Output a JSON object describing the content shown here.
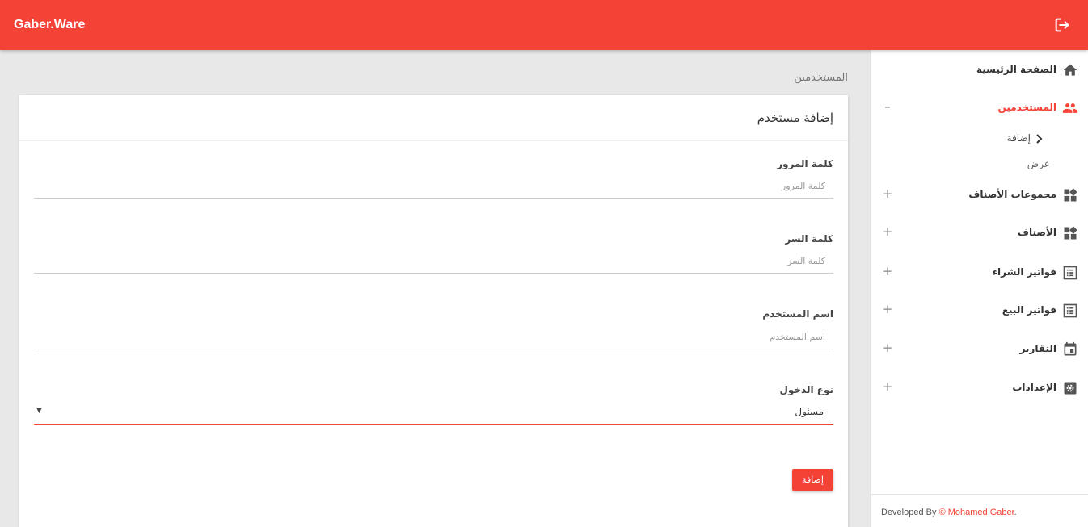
{
  "brand": "Gaber.Ware",
  "breadcrumb": "المستخدمين",
  "form": {
    "title": "إضافة مستخدم",
    "fields": [
      {
        "label": "كلمة المرور",
        "placeholder": "كلمة المرور"
      },
      {
        "label": "كلمة السر",
        "placeholder": "كلمة السر"
      },
      {
        "label": "اسم المستخدم",
        "placeholder": "اسم المستخدم"
      }
    ],
    "login_type": {
      "label": "نوع الدخول",
      "value": "مسئول"
    },
    "submit_label": "إضافة"
  },
  "sidebar": {
    "items": [
      {
        "label": "الصفحة الرئيسية",
        "icon": "home-icon",
        "toggle": ""
      },
      {
        "label": "المستخدمين",
        "icon": "users-icon",
        "toggle": "–",
        "active": true
      },
      {
        "label": "مجموعات الأصناف",
        "icon": "widgets-icon",
        "toggle": "+"
      },
      {
        "label": "الأصناف",
        "icon": "widgets-icon",
        "toggle": "+"
      },
      {
        "label": "فواتير الشراء",
        "icon": "list-icon",
        "toggle": "+"
      },
      {
        "label": "فواتير البيع",
        "icon": "list-icon",
        "toggle": "+"
      },
      {
        "label": "التقارير",
        "icon": "calendar-icon",
        "toggle": "+"
      },
      {
        "label": "الإعدادات",
        "icon": "settings-icon",
        "toggle": "+"
      }
    ],
    "users_submenu": [
      {
        "label": "إضافة",
        "active": true
      },
      {
        "label": "عرض"
      }
    ]
  },
  "footer": {
    "prefix": "Developed By",
    "copyright": "©",
    "author": "Mohamed Gaber",
    "suffix": "."
  },
  "colors": {
    "accent": "#f44336",
    "background": "#e8e8e8"
  }
}
